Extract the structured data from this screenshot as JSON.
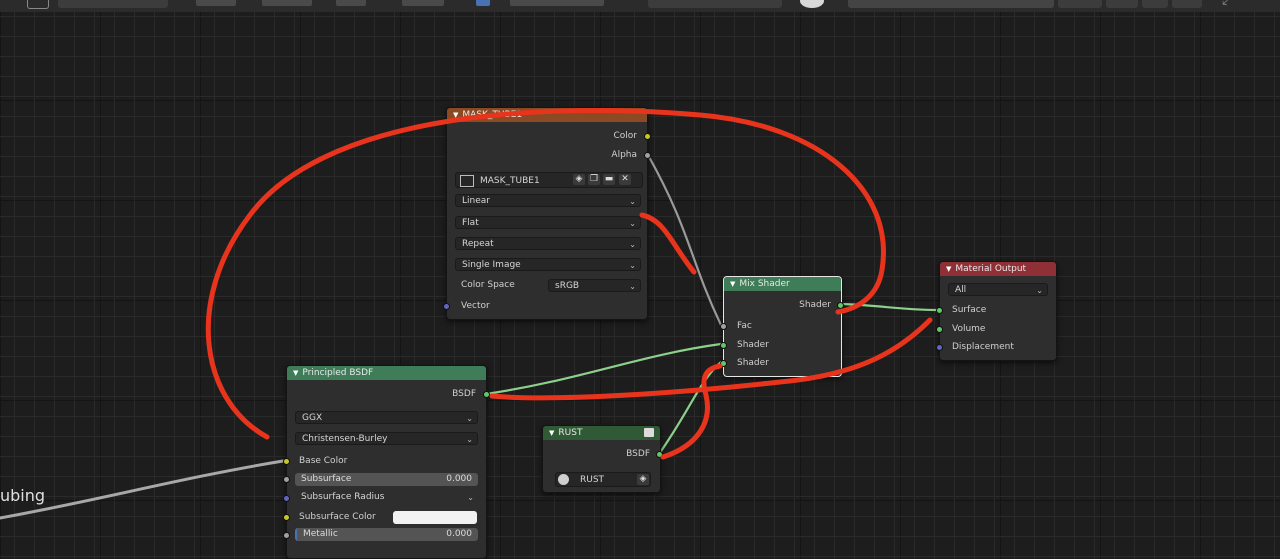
{
  "colors": {
    "background": "#1d1d1d",
    "texture_header": "#8b4a23",
    "shader_header": "#3e7d58",
    "output_header": "#8f2f36",
    "annotation_stroke": "#e8341c"
  },
  "texture_node": {
    "title": "MASK_TUBE1",
    "out_color": "Color",
    "out_alpha": "Alpha",
    "image_name": "MASK_TUBE1",
    "interpolation": "Linear",
    "projection": "Flat",
    "extension": "Repeat",
    "source": "Single Image",
    "color_space_label": "Color Space",
    "color_space_value": "sRGB",
    "in_vector": "Vector",
    "icons": [
      "image-icon",
      "shield-icon",
      "copy-icon",
      "folder-icon",
      "close-icon"
    ]
  },
  "mix_node": {
    "title": "Mix Shader",
    "out_shader": "Shader",
    "in_fac": "Fac",
    "in_shader_1": "Shader",
    "in_shader_2": "Shader"
  },
  "output_node": {
    "title": "Material Output",
    "target": "All",
    "in_surface": "Surface",
    "in_volume": "Volume",
    "in_displacement": "Displacement"
  },
  "bsdf_node": {
    "title": "Principled BSDF",
    "out_bsdf": "BSDF",
    "distribution": "GGX",
    "subsurface_method": "Christensen-Burley",
    "base_color": "Base Color",
    "subsurface": "Subsurface",
    "subsurface_value": "0.000",
    "subsurface_radius": "Subsurface Radius",
    "subsurface_color": "Subsurface Color",
    "metallic": "Metallic",
    "metallic_value": "0.000"
  },
  "rust_node": {
    "title": "RUST",
    "out_bsdf": "BSDF",
    "group_name": "RUST"
  },
  "side_text": "ubing"
}
